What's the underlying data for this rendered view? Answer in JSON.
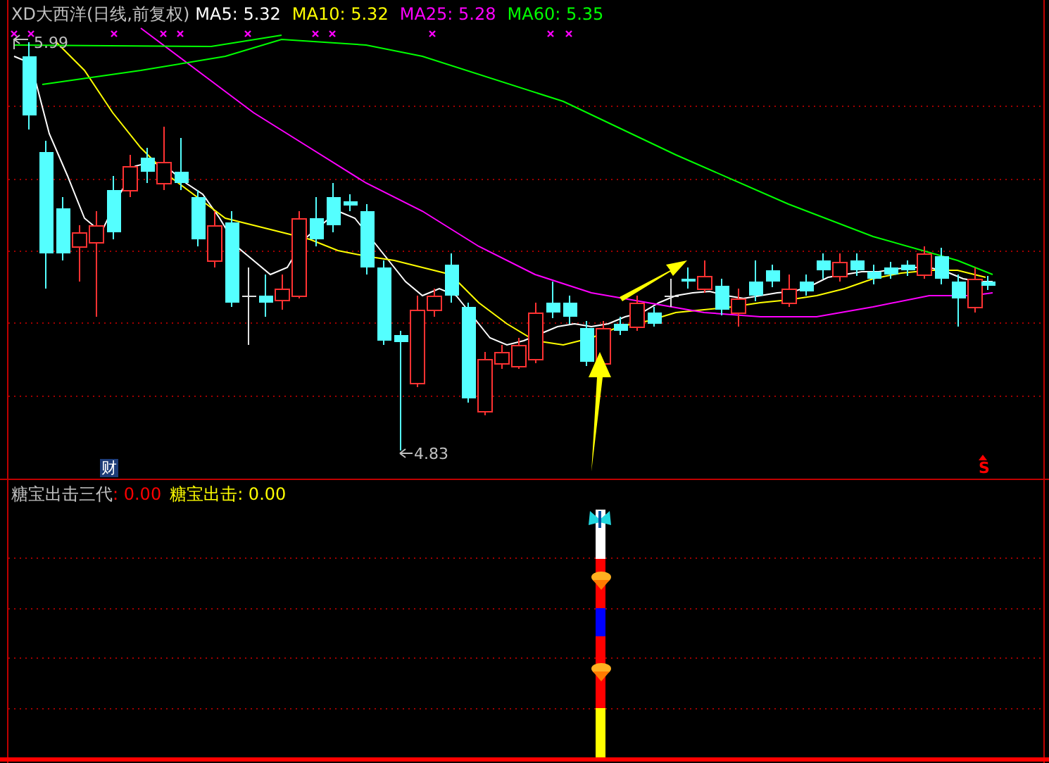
{
  "chart": {
    "title": "XD大西洋(日线,前复权)",
    "ma_legend": [
      {
        "label": "MA5: 5.32",
        "color": "#ffffff"
      },
      {
        "label": "MA10: 5.32",
        "color": "#ffff00"
      },
      {
        "label": "MA25: 5.28",
        "color": "#ff00ff"
      },
      {
        "label": "MA60: 5.35",
        "color": "#00ff00"
      }
    ],
    "high_label": "5.99",
    "low_label": "4.83",
    "finance_badge": "财",
    "signal_mark": "S"
  },
  "indicator": {
    "legend": [
      {
        "label": "糖宝出击三代",
        "color": "#c0c0c0"
      },
      {
        "label": ": 0.00",
        "color": "#ff0000"
      },
      {
        "label": "糖宝出击: 0.00",
        "color": "#ffff00"
      }
    ]
  }
}
